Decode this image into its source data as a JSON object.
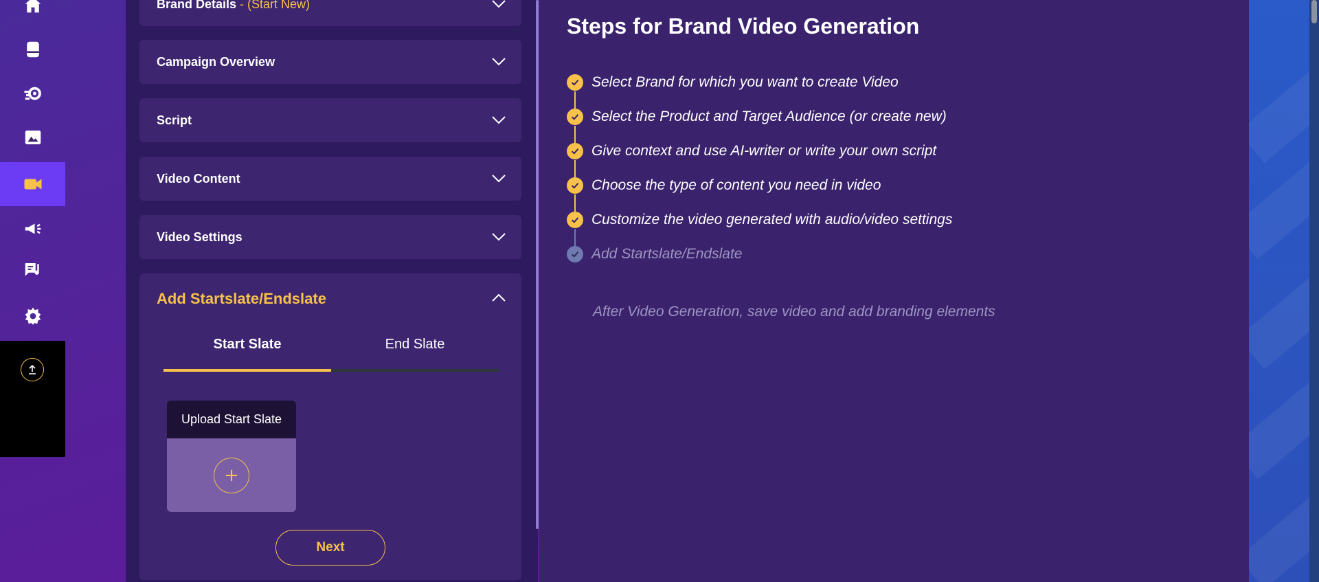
{
  "sidebar": {
    "items": [
      {
        "icon": "home-icon"
      },
      {
        "icon": "book-icon"
      },
      {
        "icon": "brain-gear-icon"
      },
      {
        "icon": "image-icon"
      },
      {
        "icon": "video-camera-icon",
        "active": true
      },
      {
        "icon": "megaphone-icon"
      },
      {
        "icon": "music-script-icon"
      },
      {
        "icon": "gear-icon"
      }
    ],
    "bottom_icon": "upload-icon"
  },
  "accordions": [
    {
      "title": "Brand Details",
      "subtitle": " - (Start New)"
    },
    {
      "title": "Campaign Overview"
    },
    {
      "title": "Script"
    },
    {
      "title": "Video Content"
    },
    {
      "title": "Video Settings"
    }
  ],
  "startslate": {
    "title": "Add Startslate/Endslate",
    "tabs": [
      "Start Slate",
      "End Slate"
    ],
    "active_tab": 0,
    "upload_label": "Upload Start Slate",
    "plus_symbol": "+",
    "next_label": "Next"
  },
  "steps_panel": {
    "title": "Steps for Brand Video Generation",
    "steps": [
      {
        "text": "Select Brand for which you want to create Video",
        "done": true
      },
      {
        "text": "Select the Product and Target Audience (or create new)",
        "done": true
      },
      {
        "text": "Give context and use AI-writer or write your own script",
        "done": true
      },
      {
        "text": "Choose the type of content you need in video",
        "done": true
      },
      {
        "text": "Customize the video generated with audio/video settings",
        "done": true
      },
      {
        "text": "Add Startslate/Endslate",
        "done": false
      }
    ],
    "after_note": "After Video Generation, save video and add branding elements"
  },
  "colors": {
    "accent": "#f7c14a",
    "active_nav": "#6c3cf5",
    "panel": "#3d2570"
  }
}
